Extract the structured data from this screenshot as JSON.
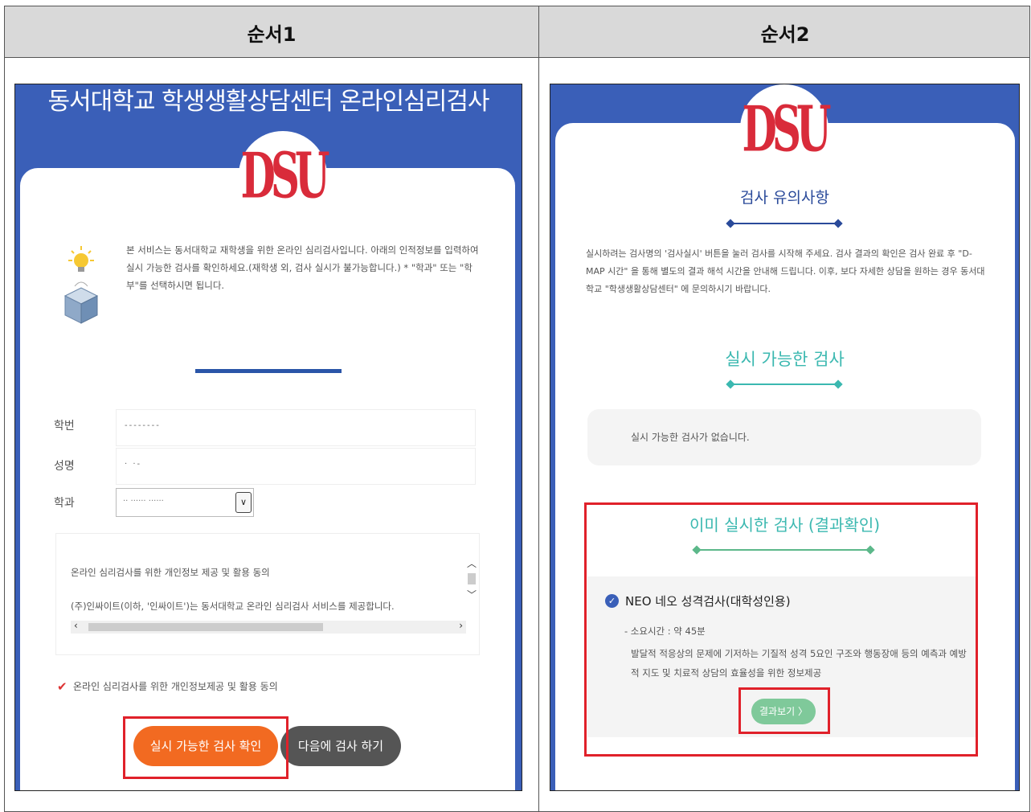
{
  "table": {
    "col1_header": "순서1",
    "col2_header": "순서2"
  },
  "step1": {
    "banner_title": "동서대학교 학생생활상담센터 온라인심리검사",
    "logo_text": "DSU",
    "intro_text": "본 서비스는 동서대학교 재학생을 위한 온라인 심리검사입니다. 아래의 인적정보를 입력하여 실시 가능한 검사를 확인하세요.(재학생 외, 검사 실시가 불가능합니다.) * \"학과\" 또는 \"학부\"를 선택하시면 됩니다.",
    "student_id_label": "학번",
    "student_id_value": "--------",
    "name_label": "성명",
    "name_value": "· ·-",
    "dept_label": "학과",
    "dept_value": "·· ······ ······",
    "consent_line1": "온라인 심리검사를 위한 개인정보 제공 및 활용 동의",
    "consent_line2": "(주)인싸이트(이하, '인싸이트')는 동서대학교 온라인 심리검사 서비스를 제공합니다.",
    "consent_checkbox_label": "온라인 심리검사를 위한 개인정보제공 및 활용 동의",
    "check_button": "실시 가능한 검사 확인",
    "later_button": "다음에 검사 하기"
  },
  "step2": {
    "logo_text": "DSU",
    "notice_title": "검사 유의사항",
    "notice_text": "실시하려는 검사명의 '검사실시' 버튼을 눌러 검사를 시작해 주세요. 검사 결과의 확인은 검사 완료 후 \"D-MAP 시간\" 을 통해 별도의 결과 해석 시간을 안내해 드립니다. 이후, 보다 자세한 상담을 원하는 경우 동서대학교 \"학생생활상담센터\" 에 문의하시기 바랍니다.",
    "available_title": "실시 가능한 검사",
    "available_empty": "실시 가능한 검사가 없습니다.",
    "done_title": "이미 실시한 검사 (결과확인)",
    "test_name": "NEO 네오 성격검사(대학성인용)",
    "test_time": "- 소요시간 : 약 45분",
    "test_desc": "발달적 적응상의 문제에 기저하는 기질적 성격 5요인 구조와 행동장애 등의 예측과 예방적 지도 및 치료적 상담의 효율성을 위한 정보제공",
    "result_button": "결과보기 〉"
  },
  "colors": {
    "header_blue": "#3a5fb8",
    "accent_orange": "#f26a21",
    "highlight_red": "#e0212a",
    "teal": "#3bb8b0",
    "green": "#7fc99a"
  }
}
